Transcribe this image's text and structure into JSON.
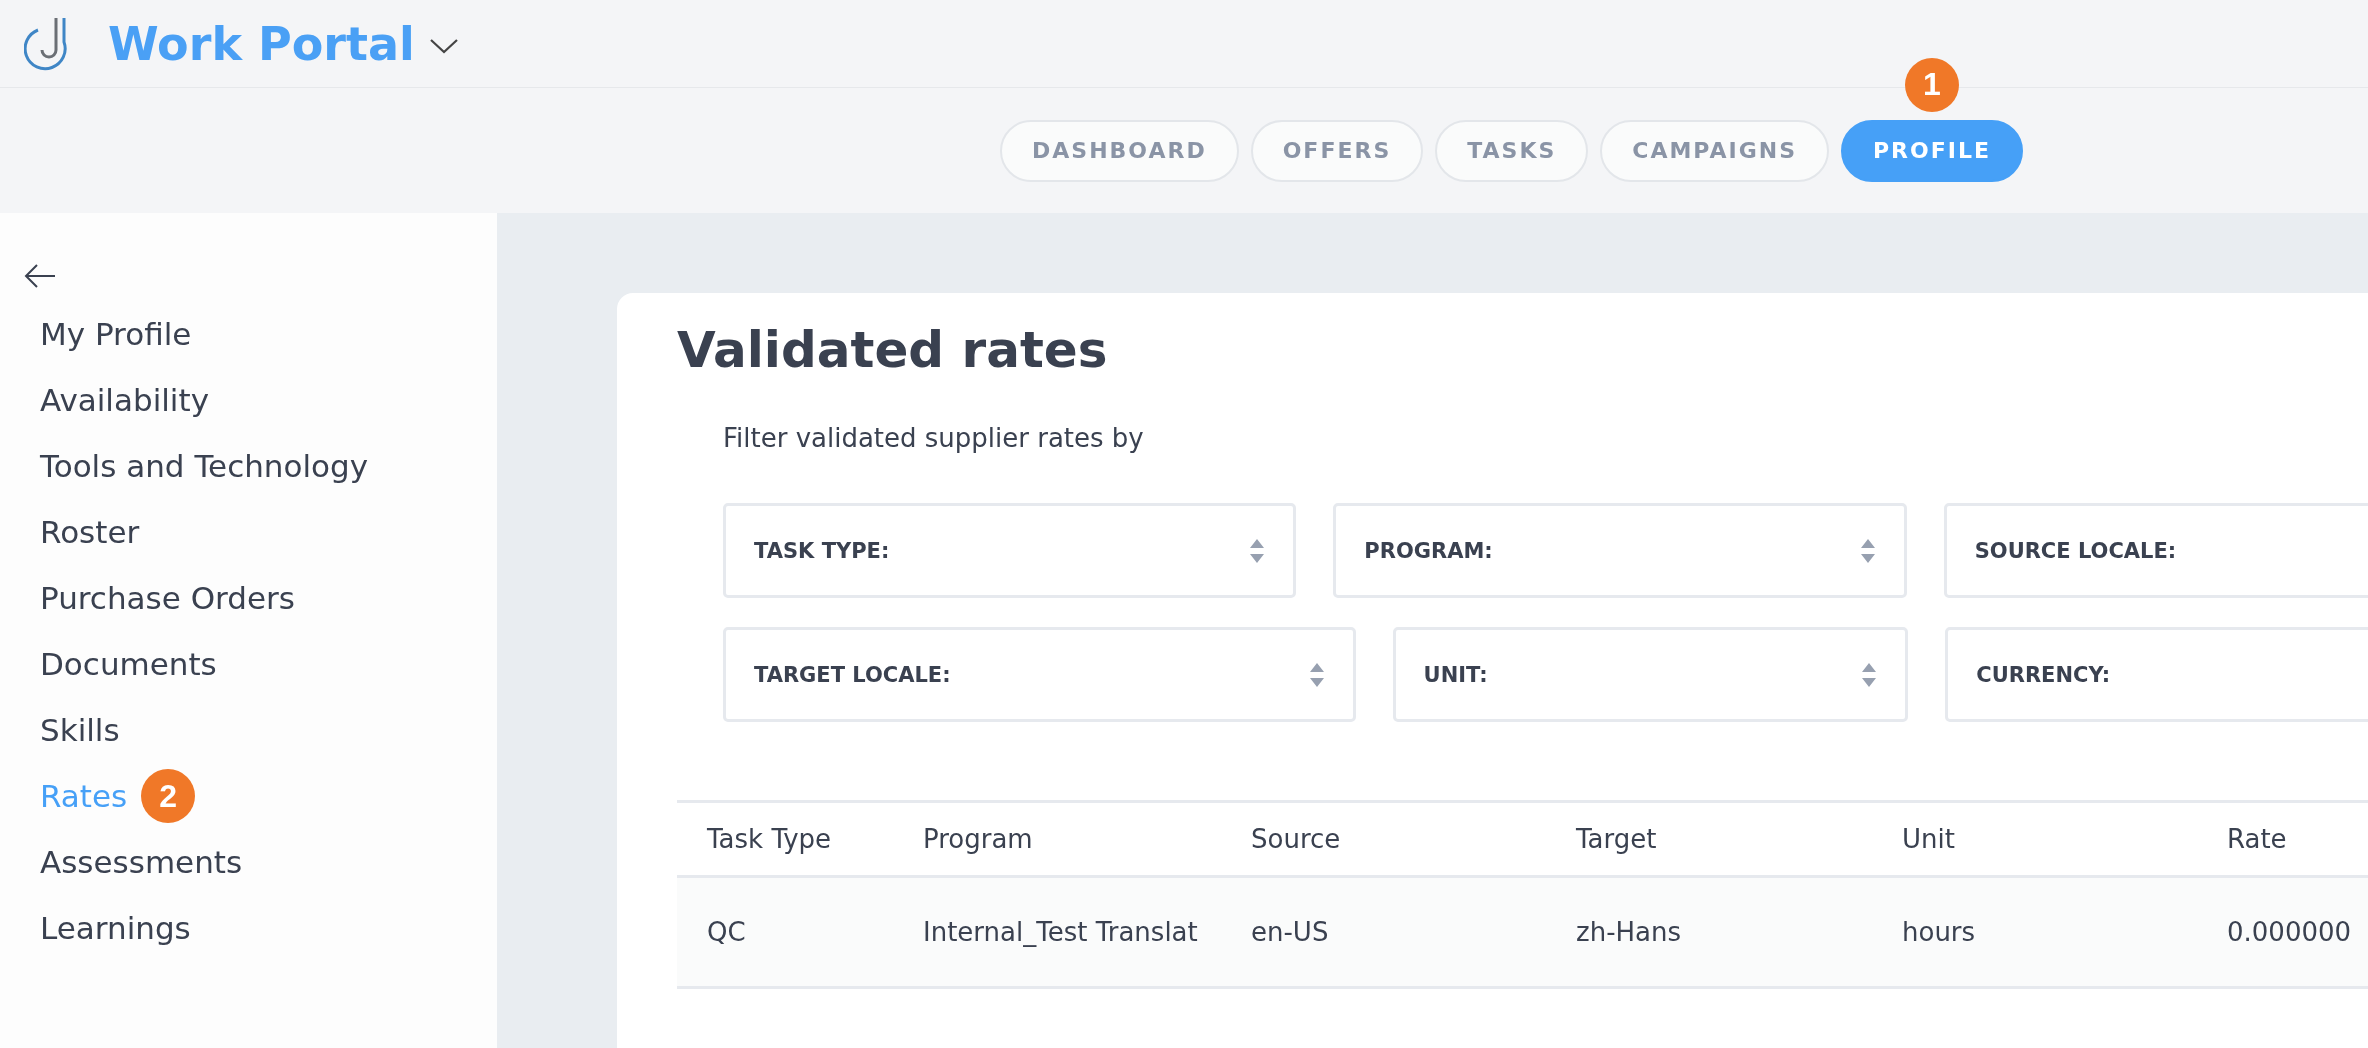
{
  "header": {
    "title": "Work Portal"
  },
  "nav_tabs": [
    {
      "label": "DASHBOARD",
      "selected": false
    },
    {
      "label": "OFFERS",
      "selected": false
    },
    {
      "label": "TASKS",
      "selected": false
    },
    {
      "label": "CAMPAIGNS",
      "selected": false
    },
    {
      "label": "PROFILE",
      "selected": true,
      "badge": "1"
    }
  ],
  "sidebar": {
    "items": [
      {
        "label": "My Profile",
        "selected": false
      },
      {
        "label": "Availability",
        "selected": false
      },
      {
        "label": "Tools and Technology",
        "selected": false
      },
      {
        "label": "Roster",
        "selected": false
      },
      {
        "label": "Purchase Orders",
        "selected": false
      },
      {
        "label": "Documents",
        "selected": false
      },
      {
        "label": "Skills",
        "selected": false
      },
      {
        "label": "Rates",
        "selected": true,
        "badge": "2"
      },
      {
        "label": "Assessments",
        "selected": false
      },
      {
        "label": "Learnings",
        "selected": false
      }
    ]
  },
  "page": {
    "title": "Validated rates",
    "filter_label": "Filter validated supplier rates by",
    "filter_rows": [
      [
        {
          "label": "TASK TYPE:"
        },
        {
          "label": "PROGRAM:"
        },
        {
          "label": "SOURCE LOCALE:"
        }
      ],
      [
        {
          "label": "TARGET LOCALE:"
        },
        {
          "label": "UNIT:"
        },
        {
          "label": "CURRENCY:"
        }
      ]
    ],
    "table": {
      "columns": [
        "Task Type",
        "Program",
        "Source",
        "Target",
        "Unit",
        "Rate"
      ],
      "rows": [
        [
          "QC",
          "Internal_Test Translat",
          "en-US",
          "zh-Hans",
          "hours",
          "0.000000"
        ]
      ]
    }
  }
}
